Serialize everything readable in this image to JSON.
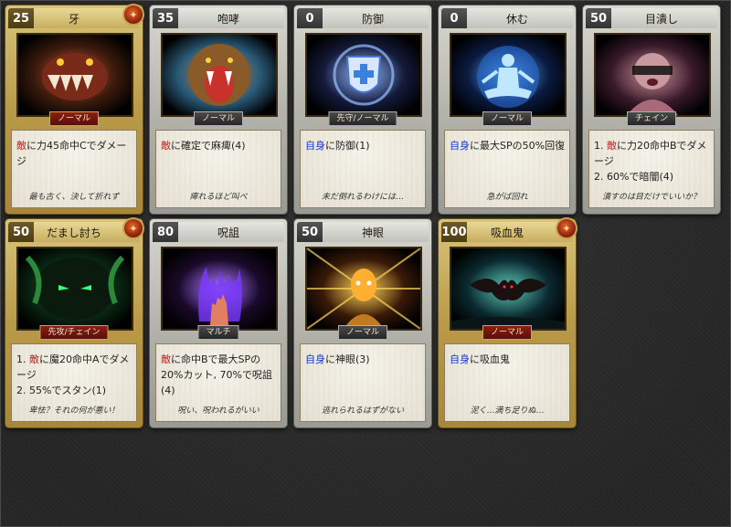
{
  "cards": [
    {
      "cost": "25",
      "name": "牙",
      "frame": "gold",
      "emblem": true,
      "tag": "ノーマル",
      "tag_color": "red",
      "effect_lines": [
        {
          "kw": "敵",
          "kw_color": "red",
          "text": "に力45命中Cでダメージ"
        }
      ],
      "flavor": "最も古く、決して折れず",
      "art": {
        "icon": "fang-beast-icon",
        "bg": "#3a1a0c",
        "accent": "#c0382a"
      }
    },
    {
      "cost": "35",
      "name": "咆哮",
      "frame": "silver",
      "emblem": false,
      "tag": "ノーマル",
      "tag_color": "dark",
      "effect_lines": [
        {
          "kw": "敵",
          "kw_color": "red",
          "text": "に確定で麻痺(4)"
        }
      ],
      "flavor": "痺れるほど叫べ",
      "art": {
        "icon": "roaring-lion-icon",
        "bg": "#2a5a78",
        "accent": "#b8742c"
      }
    },
    {
      "cost": "0",
      "name": "防御",
      "frame": "silver",
      "emblem": false,
      "tag": "先守/ノーマル",
      "tag_color": "dark",
      "effect_lines": [
        {
          "kw": "自身",
          "kw_color": "blue",
          "text": "に防御(1)"
        }
      ],
      "flavor": "未だ倒れるわけには…",
      "art": {
        "icon": "shield-cross-icon",
        "bg": "#141a3a",
        "accent": "#7aa8ff"
      }
    },
    {
      "cost": "0",
      "name": "休む",
      "frame": "silver",
      "emblem": false,
      "tag": "ノーマル",
      "tag_color": "dark",
      "effect_lines": [
        {
          "kw": "自身",
          "kw_color": "blue",
          "text": "に最大SPの50%回復"
        }
      ],
      "flavor": "急がば回れ",
      "art": {
        "icon": "meditating-figure-icon",
        "bg": "#0a1a40",
        "accent": "#3aa0ff"
      }
    },
    {
      "cost": "50",
      "name": "目潰し",
      "frame": "silver",
      "emblem": false,
      "tag": "チェイン",
      "tag_color": "dark",
      "effect_lines": [
        {
          "kw": "",
          "kw_color": "",
          "prefix": "1. ",
          "kw2": "敵",
          "text": "に力20命中Bでダメージ"
        },
        {
          "kw": "",
          "kw_color": "",
          "prefix": "2. ",
          "kw2": "",
          "text": "60%で暗闇(4)"
        }
      ],
      "flavor": "潰すのは目だけでいいか？",
      "art": {
        "icon": "blinded-figure-icon",
        "bg": "#3a1a2a",
        "accent": "#c07a88"
      }
    },
    {
      "cost": "50",
      "name": "だまし討ち",
      "frame": "gold",
      "emblem": true,
      "tag": "先攻/チェイン",
      "tag_color": "red",
      "effect_lines": [
        {
          "kw": "",
          "kw_color": "",
          "prefix": "1. ",
          "kw2": "敵",
          "text": "に魔20命中Aでダメージ"
        },
        {
          "kw": "",
          "kw_color": "",
          "prefix": "2. ",
          "kw2": "",
          "text": "55%でスタン(1)"
        }
      ],
      "flavor": "卑怯？それの何が悪い！",
      "art": {
        "icon": "lurking-eyes-icon",
        "bg": "#0a2a14",
        "accent": "#3ad05a"
      }
    },
    {
      "cost": "80",
      "name": "呪詛",
      "frame": "silver",
      "emblem": false,
      "tag": "マルチ",
      "tag_color": "dark",
      "effect_lines": [
        {
          "kw": "敵",
          "kw_color": "red",
          "text": "に命中Bで最大SPの20%カット, 70%で呪詛(4)"
        }
      ],
      "flavor": "呪い、呪われるがいい",
      "art": {
        "icon": "cursed-hand-icon",
        "bg": "#1a0a2a",
        "accent": "#9a5aff"
      }
    },
    {
      "cost": "50",
      "name": "神眼",
      "frame": "silver",
      "emblem": false,
      "tag": "ノーマル",
      "tag_color": "dark",
      "effect_lines": [
        {
          "kw": "自身",
          "kw_color": "blue",
          "text": "に神眼(3)"
        }
      ],
      "flavor": "逃れられるはずがない",
      "art": {
        "icon": "divine-eye-icon",
        "bg": "#3a1a08",
        "accent": "#ffc83a"
      }
    },
    {
      "cost": "100",
      "name": "吸血鬼",
      "frame": "gold",
      "emblem": true,
      "tag": "ノーマル",
      "tag_color": "red",
      "effect_lines": [
        {
          "kw": "自身",
          "kw_color": "blue",
          "text": "に吸血鬼"
        }
      ],
      "flavor": "泥く…満ち足りぬ…",
      "art": {
        "icon": "vampire-bat-icon",
        "bg": "#0a2a30",
        "accent": "#40c0c0"
      }
    }
  ]
}
